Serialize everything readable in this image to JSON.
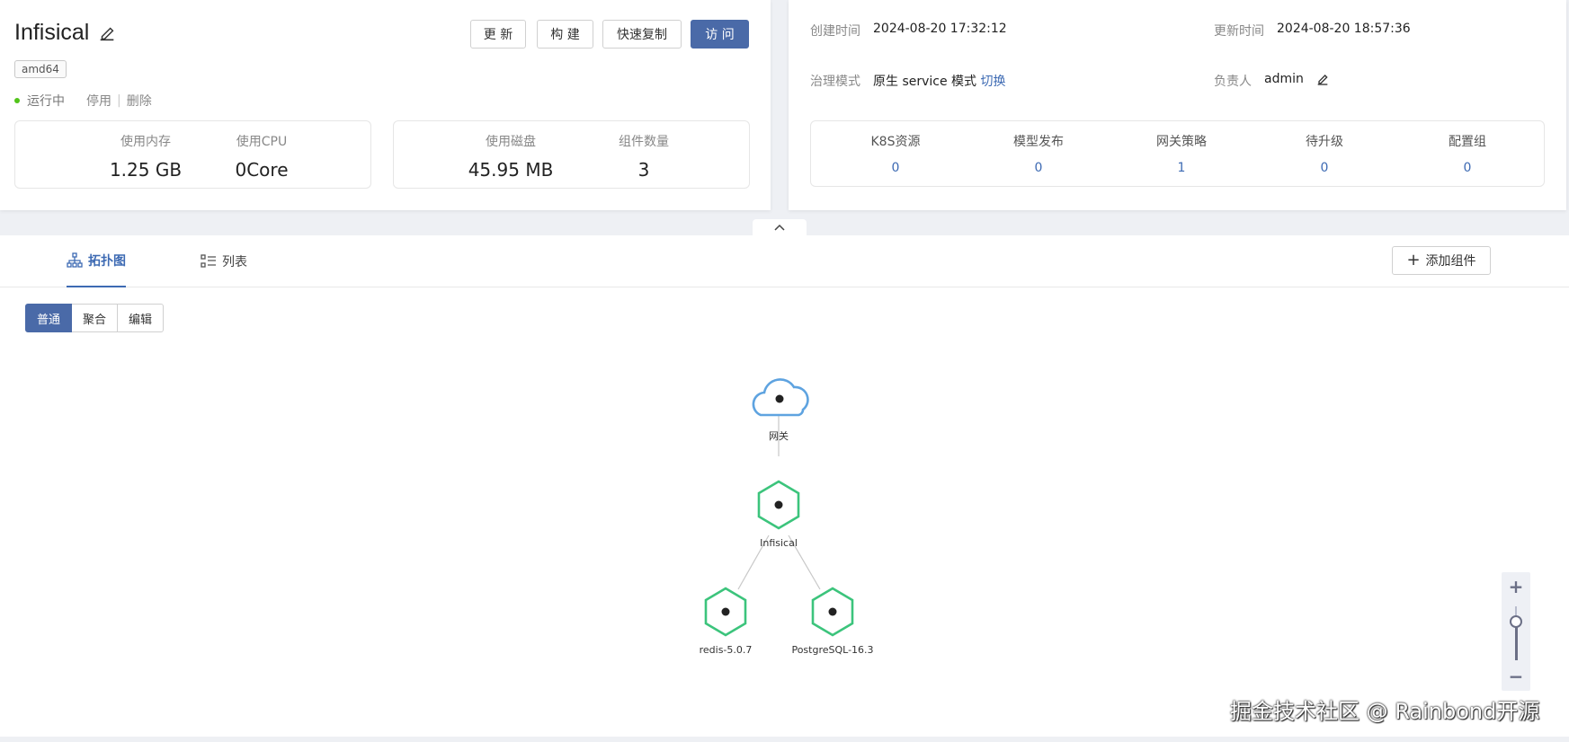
{
  "app": {
    "title": "Infisical",
    "tag": "amd64",
    "status": "运行中",
    "actions": {
      "disable": "停用",
      "delete": "删除"
    }
  },
  "buttons": {
    "update": "更 新",
    "build": "构 建",
    "quick_copy": "快速复制",
    "visit": "访 问"
  },
  "metrics": {
    "memory": {
      "label": "使用内存",
      "value": "1.25 GB"
    },
    "cpu": {
      "label": "使用CPU",
      "value": "0Core"
    },
    "disk": {
      "label": "使用磁盘",
      "value": "45.95 MB"
    },
    "components": {
      "label": "组件数量",
      "value": "3"
    }
  },
  "info": {
    "created": {
      "label": "创建时间",
      "value": "2024-08-20 17:32:12"
    },
    "updated": {
      "label": "更新时间",
      "value": "2024-08-20 18:57:36"
    },
    "governance": {
      "label": "治理模式",
      "value": "原生 service 模式",
      "switch": "切换"
    },
    "owner": {
      "label": "负责人",
      "value": "admin"
    }
  },
  "resources": [
    {
      "label": "K8S资源",
      "value": "0"
    },
    {
      "label": "模型发布",
      "value": "0"
    },
    {
      "label": "网关策略",
      "value": "1"
    },
    {
      "label": "待升级",
      "value": "0"
    },
    {
      "label": "配置组",
      "value": "0"
    }
  ],
  "tabs": {
    "topology": "拓扑图",
    "list": "列表"
  },
  "add_component": "添加组件",
  "view_modes": {
    "normal": "普通",
    "aggregate": "聚合",
    "edit": "编辑"
  },
  "topology": {
    "gateway": "网关",
    "app_node": "Infisical",
    "child_nodes": [
      "redis-5.0.7",
      "PostgreSQL-16.3"
    ]
  },
  "zoom": {
    "level": 0.7
  },
  "watermark": "掘金技术社区 @ Rainbond开源",
  "colors": {
    "primary": "#4a6aa8",
    "link": "#3d6ab3",
    "running": "#52c41a",
    "node_green": "#3cc47c",
    "cloud_blue": "#5ea3e0"
  }
}
